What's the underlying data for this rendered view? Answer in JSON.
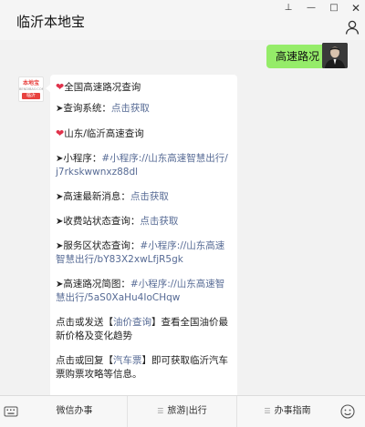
{
  "window": {
    "title": "临沂本地宝",
    "pin_glyph": "⊥",
    "minimize_glyph": "—",
    "maximize_glyph": "□",
    "close_glyph": "✕"
  },
  "outgoing": {
    "text": "高速路况"
  },
  "bot_avatar": {
    "top": "本地宝",
    "mid": "BENDIBAO.COM",
    "badge": "临沂"
  },
  "message": {
    "line1": {
      "heart": "❤",
      "text": "全国高速路况查询"
    },
    "line2": {
      "arrow": "➤",
      "label": "查询系统：",
      "link": "点击获取"
    },
    "line3": {
      "heart": "❤",
      "text": "山东/临沂高速查询"
    },
    "line4": {
      "arrow": "➤",
      "label": "小程序：",
      "link": "#小程序://山东高速智慧出行/j7rkskwwnxz88dl"
    },
    "line5": {
      "arrow": "➤",
      "label": "高速最新消息：",
      "link": "点击获取"
    },
    "line6": {
      "arrow": "➤",
      "label": "收费站状态查询：",
      "link": "点击获取"
    },
    "line7": {
      "arrow": "➤",
      "label": "服务区状态查询：",
      "link": "#小程序://山东高速智慧出行/bY83X2xwLfjR5gk"
    },
    "line8": {
      "arrow": "➤",
      "label": "高速路况简图：",
      "link": "#小程序://山东高速智慧出行/5aS0XaHu4IoCHqw"
    },
    "line9": {
      "pre": "点击或发送【",
      "link": "油价查询",
      "post": "】查看全国油价最新价格及变化趋势"
    },
    "line10": {
      "pre": "点击或回复【",
      "link": "汽车票",
      "post": "】即可获取临沂汽车票购票攻略等信息。"
    }
  },
  "menu": {
    "items": [
      {
        "label": "微信办事"
      },
      {
        "icon": "☰",
        "label": "旅游|出行"
      },
      {
        "icon": "☰",
        "label": "办事指南"
      }
    ]
  },
  "colors": {
    "outgoing_bubble": "#95ec69",
    "link": "#576b95",
    "heart": "#e0324b",
    "brand_red": "#e8423f"
  },
  "icons": [
    "pin-icon",
    "minimize-icon",
    "maximize-icon",
    "close-icon",
    "person-icon",
    "keyboard-icon",
    "emoji-icon"
  ]
}
